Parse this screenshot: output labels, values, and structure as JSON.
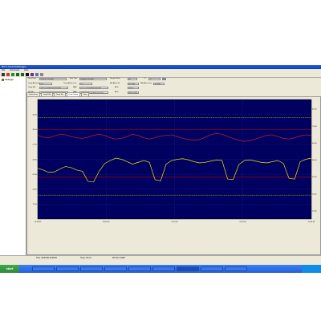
{
  "window": {
    "title": "RH & Temp Datalogger",
    "menu": [
      "File",
      "Instrument",
      "Help"
    ]
  },
  "sidebar": {
    "device": "datalogger"
  },
  "info": {
    "start_time_label": "Start Time",
    "start_time": "04/07/09 15:46:00",
    "end_time_label": "End Time",
    "end_time": "04/08/09 02:46:00",
    "sample_rate_label": "Sample Rate",
    "sample_rate": "60",
    "unit_label": "°C",
    "unit_value": "°C",
    "temp_alarm_high_label": "Temp Alarm Hi",
    "temp_alarm_high": "40 C",
    "temp_alarm_low_label": "Temp Alarm Low",
    "temp_alarm_low": "0 C",
    "rh_alarm_high_label": "RH Alarm Hi",
    "rh_alarm_high": "80 %RH",
    "rh_alarm_low_label": "RH Alarm Low",
    "rh_alarm_low": "30 %RH",
    "temp_min_label": "Temp Min",
    "temp_min": "20.6 C @ 04/07/09 19:07:00",
    "temp_max_label": "MAX",
    "temp_max": "27.1 C @ 07/10/09 15:07:00",
    "temp_avg_label": "AVG",
    "temp_avg": "24.6 C",
    "rh_min_label": "RH Min",
    "rh_min": "28.8 %RH @ 04/08/09 10:09:00",
    "rh_max_label": "MAX",
    "rh_max": "55.0 %RH @ 07/10/09 15:07:00",
    "rh_avg_label": "AVG",
    "rh_avg": "40.89 %RH"
  },
  "tabs": [
    "Datascreen",
    "Limit(C/F)",
    "Temp Set",
    "Color Setup",
    "View"
  ],
  "active_tab": 3,
  "status": {
    "time": "Time: 04/07/09 15:46:56",
    "temp": "Temp: 25.4 C",
    "rh": "RH: 52.1 %RH"
  },
  "taskbar": {
    "start": "start",
    "tasks": [
      "",
      "",
      "",
      "",
      "",
      "",
      "",
      "",
      ""
    ],
    "clock": ""
  },
  "colors": {
    "plot_bg": "#000060",
    "temp_line": "#e6e600",
    "rh_line": "#e02020",
    "limit_yellow": "#cccc00",
    "limit_red": "#cc0000",
    "grid": "#3c3c9a"
  },
  "chart_data": {
    "type": "line",
    "series": [
      {
        "values": [
          29,
          28.7,
          28.6,
          28.9,
          29.2,
          29.1,
          28.8,
          28.6,
          28.5,
          28.7,
          29.0,
          29.2,
          29.0,
          28.6,
          28.4,
          28.5,
          28.8,
          29.2,
          29.0,
          28.6,
          28.4,
          28.6,
          28.9,
          29.0,
          29.1,
          28.8,
          28.5,
          28.3,
          28.2,
          28.3,
          28.7,
          29.1,
          29.3,
          29.2,
          28.8,
          28.5,
          28.2,
          28.0,
          28.1,
          28.4,
          28.7,
          29.0,
          29.1,
          28.8,
          28.5,
          28.4,
          28.6,
          28.9,
          29.1,
          29.0
        ]
      },
      {
        "values": [
          23.5,
          23.2,
          22.8,
          22.9,
          23.4,
          23.8,
          23.6,
          23.2,
          23.0,
          21.3,
          21.2,
          23.0,
          24.3,
          24.8,
          25.2,
          25.0,
          24.6,
          24.2,
          24.5,
          24.8,
          24.5,
          21.6,
          21.4,
          24.2,
          24.8,
          25.0,
          25.1,
          24.9,
          24.6,
          24.4,
          24.5,
          24.7,
          24.9,
          24.8,
          21.7,
          21.6,
          24.1,
          24.8,
          24.9,
          24.7,
          24.5,
          24.4,
          24.6,
          24.8,
          24.3,
          21.8,
          21.7,
          24.6,
          25.0,
          25.2
        ]
      }
    ],
    "y_left": {
      "ylim": [
        15,
        35
      ],
      "ticks": [
        "17.50",
        "20.00",
        "22.50",
        "25.00",
        "27.50",
        "30.00",
        "32.50"
      ]
    },
    "y_right": {
      "ticks": [
        "20.00",
        "30.00",
        "40.00",
        "50.00",
        "60.00",
        "70.00",
        "80.00"
      ]
    },
    "x_ticks": [
      "15:46:00",
      "18:33:00",
      "21:20:00",
      "00:07:00",
      "02:46:00"
    ],
    "limit_lines": [
      {
        "value": 32.0,
        "style": "dotted",
        "color": "#cccc00"
      },
      {
        "value": 30.0,
        "style": "solid",
        "color": "#cc0000"
      },
      {
        "value": 22.0,
        "style": "solid",
        "color": "#cc0000"
      },
      {
        "value": 19.0,
        "style": "dotted",
        "color": "#cccc00"
      }
    ]
  }
}
